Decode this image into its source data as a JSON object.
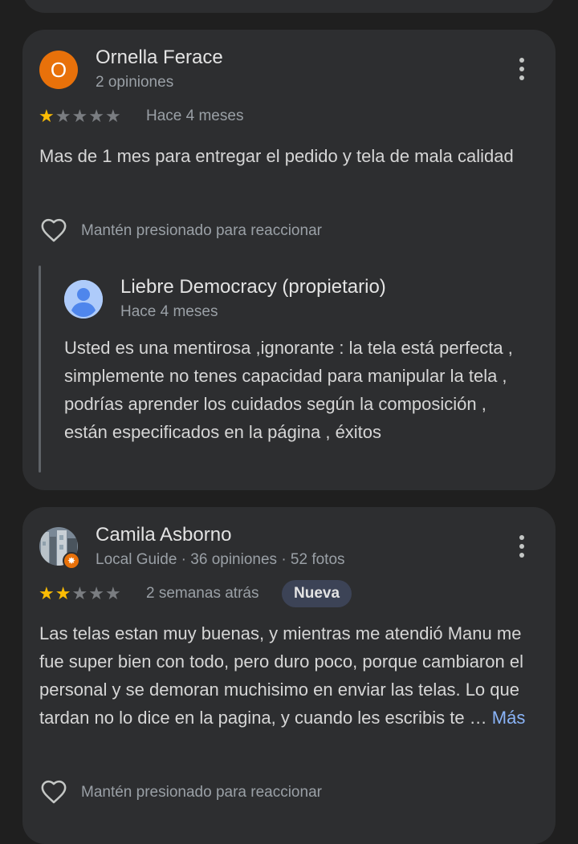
{
  "reviews": [
    {
      "author": "Ornella Ferace",
      "avatar_letter": "O",
      "meta": "2 opiniones",
      "rating": 1,
      "time": "Hace 4 meses",
      "text": "Mas de 1 mes para entregar el pedido y tela de mala calidad",
      "react_label": "Mantén presionado para reaccionar",
      "reply": {
        "author": "Liebre Democracy (propietario)",
        "time": "Hace 4 meses",
        "text": "Usted es una mentirosa ,ignorante : la tela está perfecta , simplemente no tenes capacidad para manipular la tela , podrías aprender los cuidados según la composición , están especificados en la página , éxitos"
      }
    },
    {
      "author": "Camila Asborno",
      "meta": "Local Guide · 36 opiniones · 52 fotos",
      "rating": 2,
      "time": "2 semanas atrás",
      "badge": "Nueva",
      "text": "Las telas estan muy buenas, y mientras me atendió Manu me fue super bien con todo, pero duro poco, porque cambiaron el personal y se demoran muchisimo en enviar las telas. Lo que tardan no lo dice en la pagina, y cuando les escribis te …",
      "more_label": "Más",
      "react_label": "Mantén presionado para reaccionar"
    }
  ],
  "colors": {
    "star_on": "#fbbc04",
    "star_off": "#7a7d81",
    "avatar_orange": "#e8710a",
    "link": "#8ab4f8",
    "badge_bg": "#3c4356"
  },
  "icons": [
    "more-vert-icon",
    "star-icon",
    "heart-outline-icon",
    "person-icon",
    "local-guide-badge-icon"
  ]
}
